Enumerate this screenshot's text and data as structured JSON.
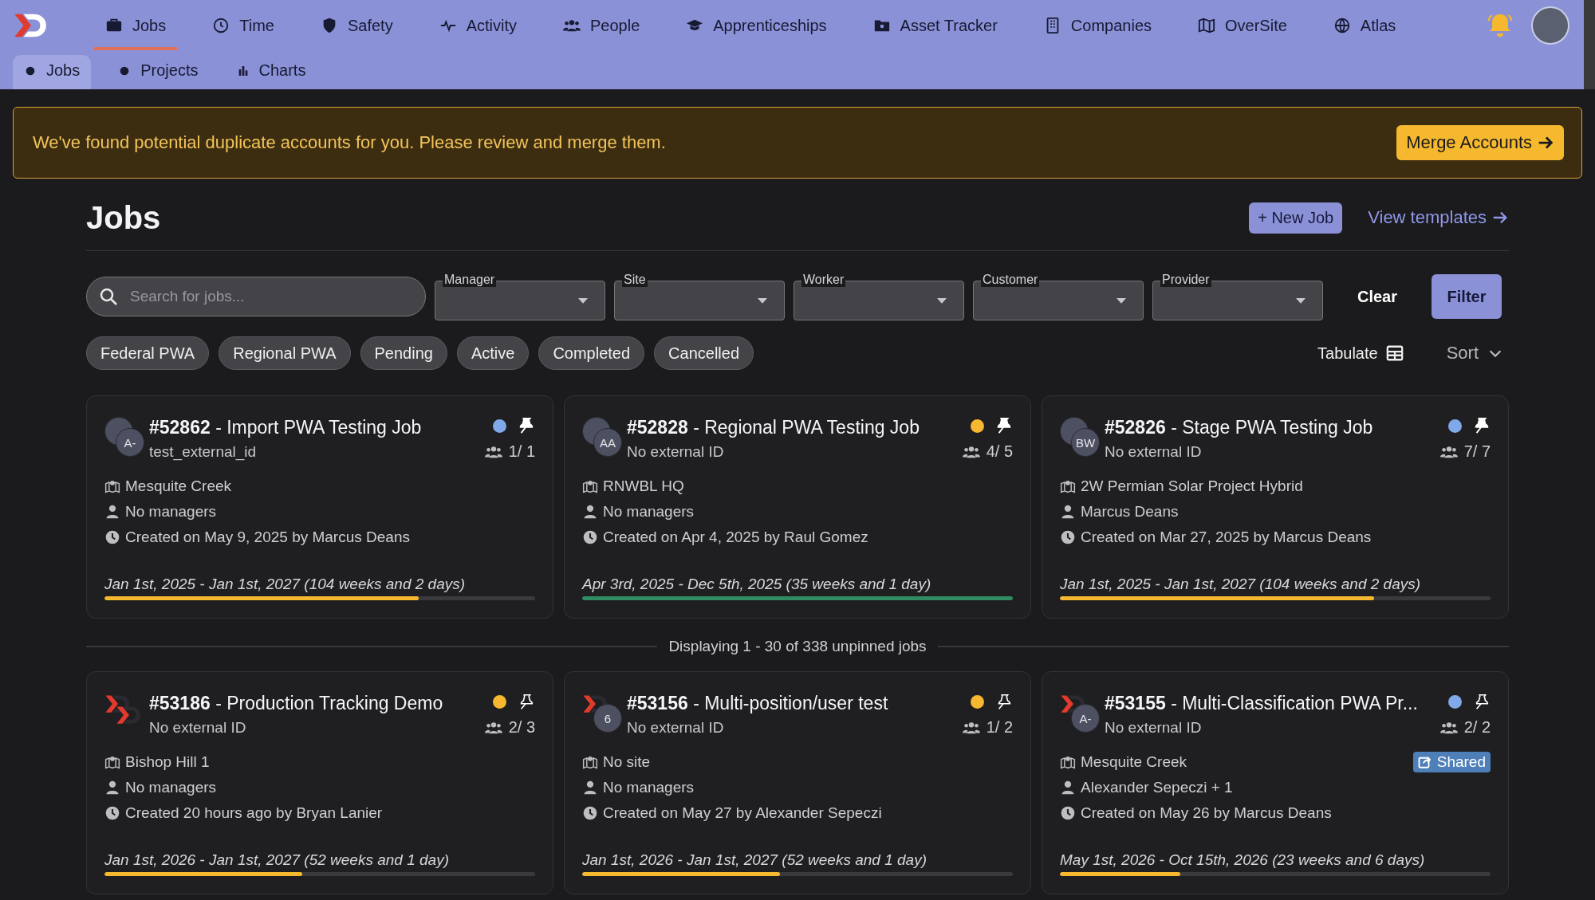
{
  "nav": {
    "tabs": [
      {
        "label": "Jobs",
        "selected": true
      },
      {
        "label": "Time",
        "selected": false
      },
      {
        "label": "Safety",
        "selected": false
      },
      {
        "label": "Activity",
        "selected": false
      },
      {
        "label": "People",
        "selected": false
      },
      {
        "label": "Apprenticeships",
        "selected": false
      },
      {
        "label": "Asset Tracker",
        "selected": false
      },
      {
        "label": "Companies",
        "selected": false
      },
      {
        "label": "OverSite",
        "selected": false
      },
      {
        "label": "Atlas",
        "selected": false
      }
    ],
    "subtabs": [
      {
        "label": "Jobs",
        "selected": true
      },
      {
        "label": "Projects",
        "selected": false
      },
      {
        "label": "Charts",
        "selected": false
      }
    ]
  },
  "banner": {
    "message": "We've found potential duplicate accounts for you. Please review and merge them.",
    "button": "Merge Accounts"
  },
  "page": {
    "title": "Jobs",
    "new_button": "+ New Job",
    "templates_link": "View templates"
  },
  "filters": {
    "search_placeholder": "Search for jobs...",
    "dropdowns": [
      "Manager",
      "Site",
      "Worker",
      "Customer",
      "Provider"
    ],
    "clear": "Clear",
    "filter": "Filter"
  },
  "chips": [
    "Federal PWA",
    "Regional PWA",
    "Pending",
    "Active",
    "Completed",
    "Cancelled"
  ],
  "tabulate": "Tabulate",
  "sort": "Sort",
  "pinned_jobs": [
    {
      "avatars": [
        {
          "kind": "covered"
        },
        {
          "kind": "initials",
          "text": "A-"
        }
      ],
      "title": "**#52862** - Import PWA Testing Job",
      "external_id": "test_external_id",
      "color": "#7fa9e8",
      "pinned": true,
      "workers": "1/ 1",
      "site": "Mesquite Creek",
      "managers": "No managers",
      "created": "Created on May 9, 2025 by Marcus Deans",
      "dates": "Jan 1st, 2025 - Jan 1st, 2027 (104 weeks and 2 days)",
      "level": 0.73,
      "finished": false
    },
    {
      "avatars": [
        {
          "kind": "covered"
        },
        {
          "kind": "initials",
          "text": "AA"
        }
      ],
      "title": "**#52828** - Regional PWA Testing Job",
      "external_id": "No external ID",
      "color": "#f5b82e",
      "pinned": true,
      "workers": "4/ 5",
      "site": "RNWBL HQ",
      "managers": "No managers",
      "created": "Created on Apr 4, 2025 by Raul Gomez",
      "dates": "Apr 3rd, 2025 - Dec 5th, 2025 (35 weeks and 1 day)",
      "level": 1,
      "finished": true
    },
    {
      "avatars": [
        {
          "kind": "covered"
        },
        {
          "kind": "initials",
          "text": "BW"
        }
      ],
      "title": "**#52826** - Stage PWA Testing Job",
      "external_id": "No external ID",
      "color": "#7fa9e8",
      "pinned": true,
      "workers": "7/ 7",
      "site": "2W Permian Solar Project Hybrid",
      "managers": "Marcus Deans",
      "created": "Created on Mar 27, 2025 by Marcus Deans",
      "dates": "Jan 1st, 2025 - Jan 1st, 2027 (104 weeks and 2 days)",
      "level": 0.73,
      "finished": false
    }
  ],
  "divider_text": "Displaying 1 - 30 of 338 unpinned jobs",
  "jobs": [
    {
      "avatars": [
        {
          "kind": "logo"
        },
        {
          "kind": "logo"
        }
      ],
      "title": "**#53186** - Production Tracking Demo",
      "external_id": "No external ID",
      "color": "#f5b82e",
      "pinned": false,
      "workers": "2/ 3",
      "site": "Bishop Hill 1",
      "managers": "No managers",
      "created": "Created 20 hours ago by Bryan Lanier",
      "dates": "Jan 1st, 2026 - Jan 1st, 2027 (52 weeks and 1 day)",
      "level": 0.46,
      "finished": false
    },
    {
      "avatars": [
        {
          "kind": "logo"
        },
        {
          "kind": "initials",
          "text": "6"
        }
      ],
      "title": "**#53156** - Multi-position/user test",
      "external_id": "No external ID",
      "color": "#f5b82e",
      "pinned": false,
      "workers": "1/ 2",
      "site": "No site",
      "managers": "No managers",
      "created": "Created on May 27 by Alexander Sepeczi",
      "dates": "Jan 1st, 2026 - Jan 1st, 2027 (52 weeks and 1 day)",
      "level": 0.46,
      "finished": false
    },
    {
      "avatars": [
        {
          "kind": "logo"
        },
        {
          "kind": "initials",
          "text": "A-"
        }
      ],
      "title": "**#53155** - Multi-Classification PWA Pr...",
      "external_id": "No external ID",
      "color": "#7fa9e8",
      "pinned": false,
      "workers": "2/ 2",
      "site": "Mesquite Creek",
      "badge": "Shared",
      "managers": "Alexander Sepeczi + 1",
      "created": "Created on May 26 by Marcus Deans",
      "dates": "May 1st, 2026 - Oct 15th, 2026 (23 weeks and 6 days)",
      "level": 0.28,
      "finished": false
    }
  ]
}
